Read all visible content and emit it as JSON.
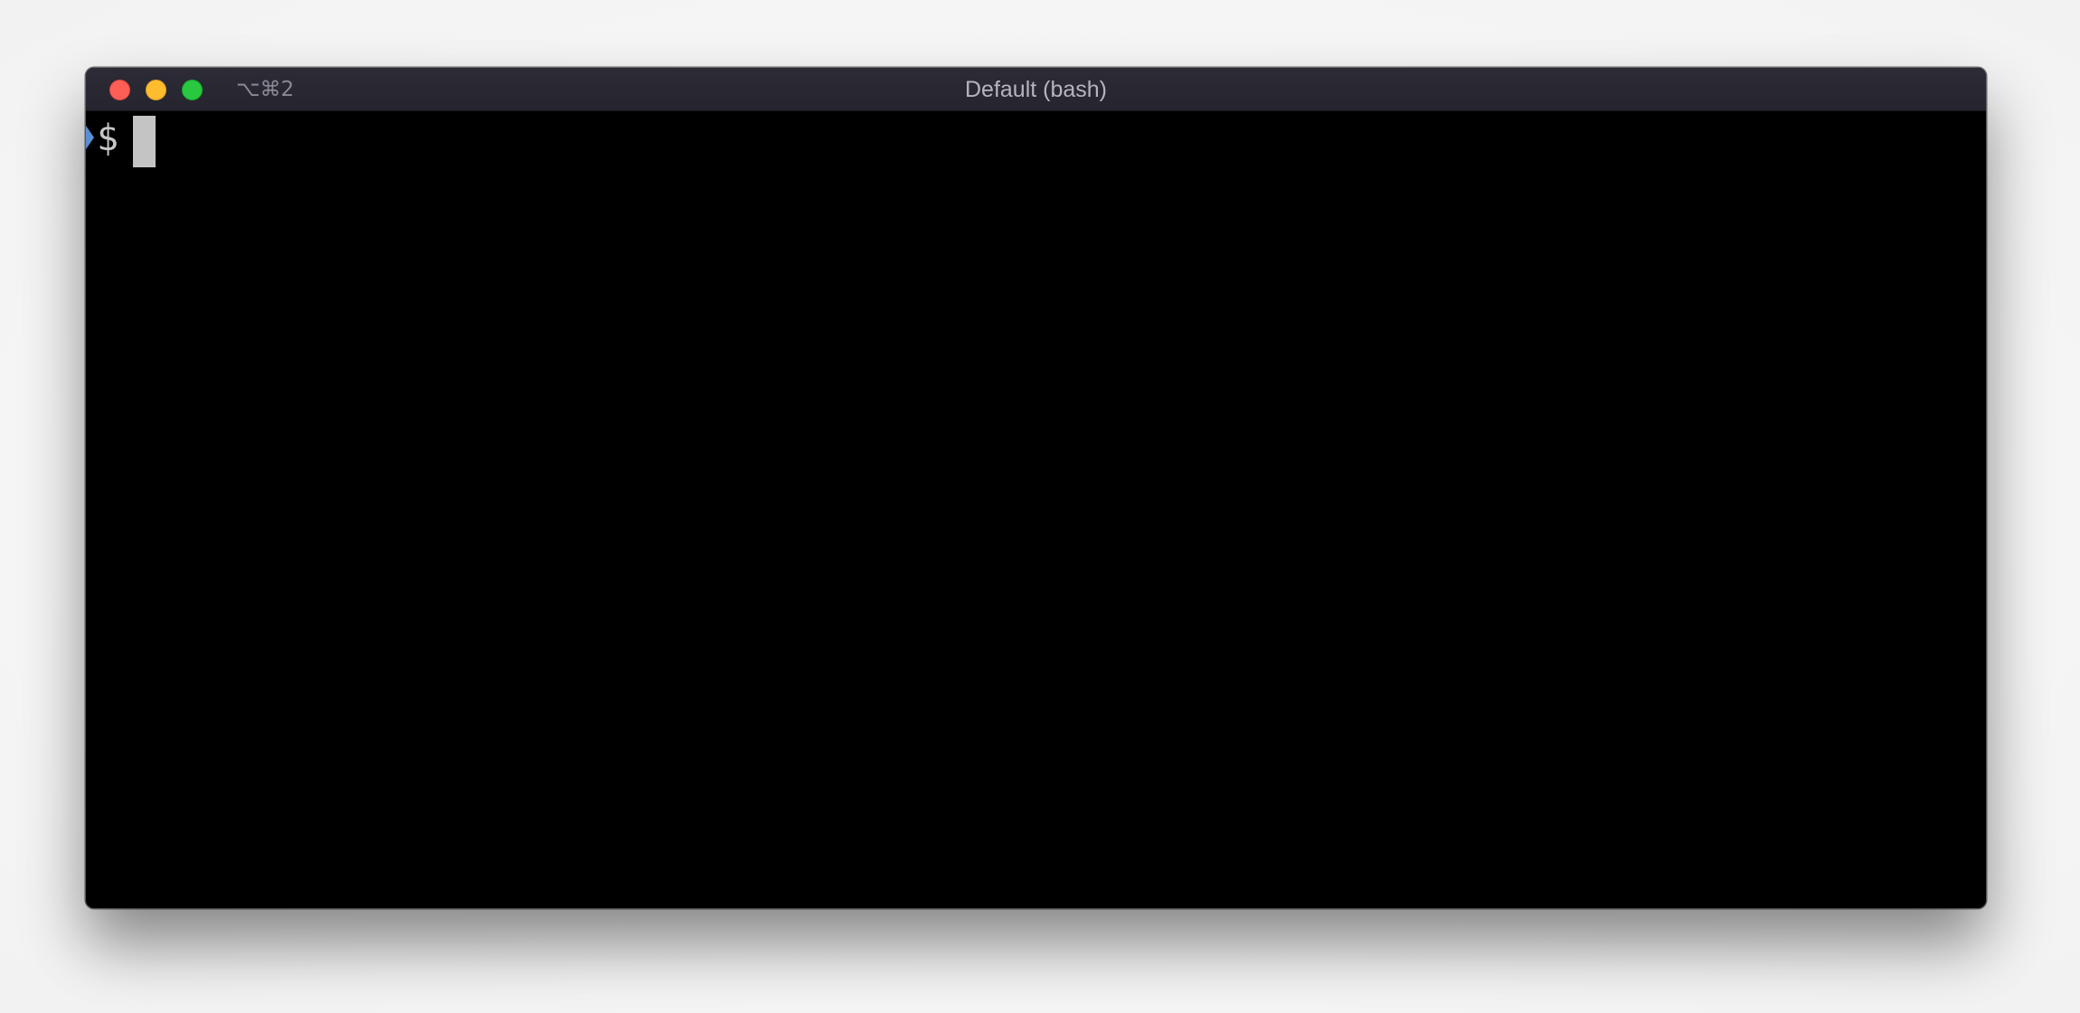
{
  "window": {
    "title": "Default (bash)",
    "shortcut": "⌥⌘2",
    "controls": {
      "close_color": "#fd5f57",
      "minimize_color": "#febc2e",
      "maximize_color": "#28c840"
    }
  },
  "terminal": {
    "prompt": "$",
    "input": "",
    "background": "#000000",
    "foreground": "#c7c7c7",
    "mark_color": "#5a8fd6"
  }
}
